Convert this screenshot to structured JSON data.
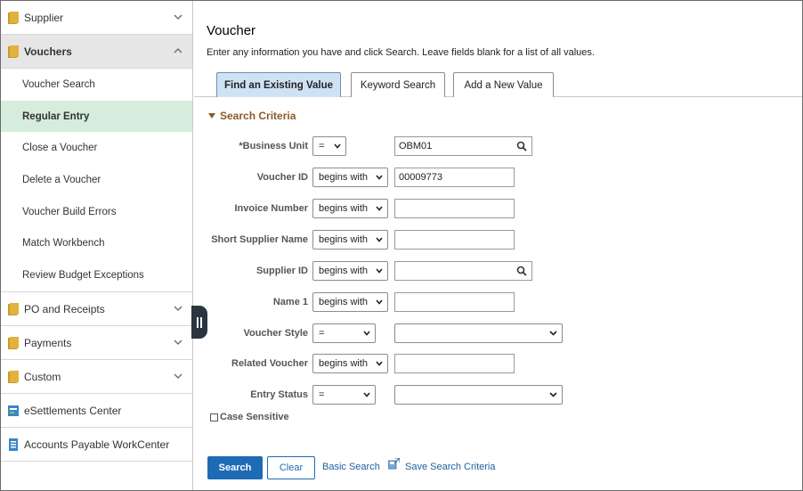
{
  "sidebar": {
    "groups_top": [
      {
        "label": "Supplier"
      },
      {
        "label": "Vouchers"
      }
    ],
    "voucher_items": [
      {
        "label": "Voucher Search"
      },
      {
        "label": "Regular Entry"
      },
      {
        "label": "Close a Voucher"
      },
      {
        "label": "Delete a Voucher"
      },
      {
        "label": "Voucher Build Errors"
      },
      {
        "label": "Match Workbench"
      },
      {
        "label": "Review Budget Exceptions"
      }
    ],
    "groups_bottom": [
      {
        "label": "PO and Receipts"
      },
      {
        "label": "Payments"
      },
      {
        "label": "Custom"
      },
      {
        "label": "eSettlements Center"
      },
      {
        "label": "Accounts Payable WorkCenter"
      }
    ]
  },
  "page": {
    "title": "Voucher",
    "instructions": "Enter any information you have and click Search. Leave fields blank for a list of all values."
  },
  "tabs": [
    {
      "label": "Find an Existing Value"
    },
    {
      "label": "Keyword Search"
    },
    {
      "label": "Add a New Value"
    }
  ],
  "search_criteria": {
    "heading": "Search Criteria",
    "rows": [
      {
        "label": "*Business Unit",
        "operator": "=",
        "value": "OBM01"
      },
      {
        "label": "Voucher ID",
        "operator": "begins with",
        "value": "00009773"
      },
      {
        "label": "Invoice Number",
        "operator": "begins with",
        "value": ""
      },
      {
        "label": "Short Supplier Name",
        "operator": "begins with",
        "value": ""
      },
      {
        "label": "Supplier ID",
        "operator": "begins with",
        "value": ""
      },
      {
        "label": "Name 1",
        "operator": "begins with",
        "value": ""
      },
      {
        "label": "Voucher Style",
        "operator": "=",
        "value": ""
      },
      {
        "label": "Related Voucher",
        "operator": "begins with",
        "value": ""
      },
      {
        "label": "Entry Status",
        "operator": "=",
        "value": ""
      }
    ],
    "case_sensitive_label": "Case Sensitive"
  },
  "actions": {
    "search": "Search",
    "clear": "Clear",
    "basic_search": "Basic Search",
    "save_search": "Save Search Criteria"
  },
  "colors": {
    "primary": "#1d6bb5",
    "active_nav": "#d6eddd",
    "active_tab": "#cfe2f5",
    "criteria_heading": "#8a5a2b"
  }
}
